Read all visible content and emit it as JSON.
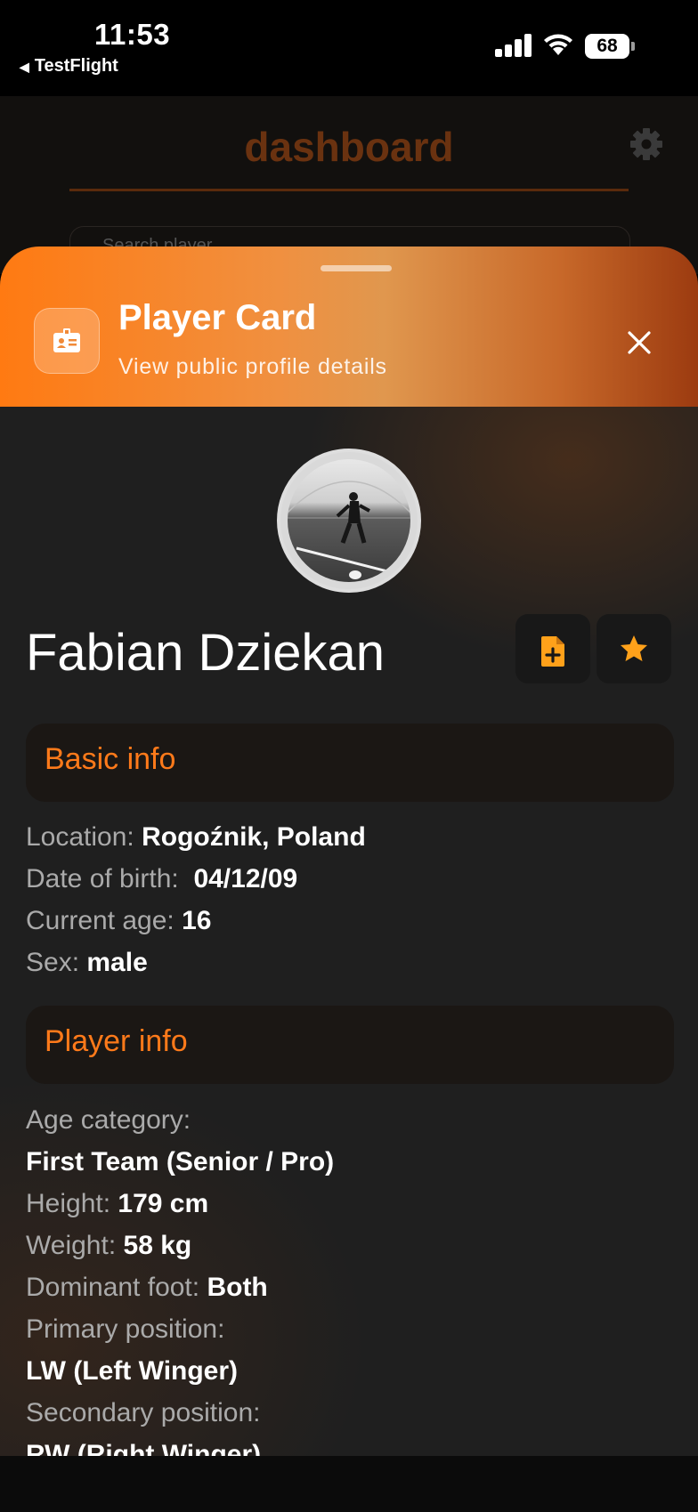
{
  "status_bar": {
    "time": "11:53",
    "back_app": "TestFlight",
    "battery": "68"
  },
  "background_screen": {
    "title": "dashboard",
    "search_placeholder": "Search player",
    "accent_color": "#6a3210"
  },
  "sheet": {
    "title": "Player Card",
    "subtitle": "View public profile details",
    "accent_color": "#ff7a12",
    "close_icon": "close-icon"
  },
  "player": {
    "name": "Fabian Dziekan",
    "actions": [
      {
        "icon": "add-note-icon",
        "color": "#ffa11a"
      },
      {
        "icon": "star-icon",
        "color": "#ffa11a"
      }
    ]
  },
  "basic_info": {
    "heading": "Basic info",
    "location_label": "Location:",
    "location_value": "Rogoźnik, Poland",
    "dob_label": "Date of birth:",
    "dob_value": "04/12/09",
    "age_label": "Current age:",
    "age_value": "16",
    "sex_label": "Sex:",
    "sex_value": "male"
  },
  "player_info": {
    "heading": "Player info",
    "age_category_label": "Age category:",
    "age_category_value": "First Team (Senior / Pro)",
    "height_label": "Height:",
    "height_value": "179 cm",
    "weight_label": "Weight:",
    "weight_value": "58 kg",
    "foot_label": "Dominant foot:",
    "foot_value": "Both",
    "primary_label": "Primary position:",
    "primary_value": "LW (Left Winger)",
    "secondary_label": "Secondary position:",
    "secondary_value": "RW (Right Winger)"
  }
}
